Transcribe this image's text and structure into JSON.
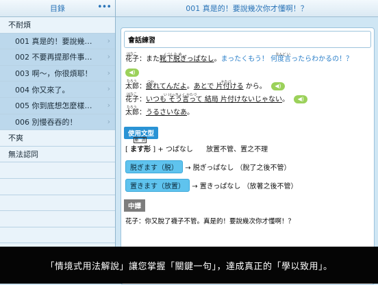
{
  "sidebar": {
    "title": "目錄",
    "more_icon": "•••",
    "items": [
      {
        "label": "不耐煩",
        "level": "top"
      },
      {
        "label": "001 真是的！要說幾次你才懂啊！？",
        "level": "sub"
      },
      {
        "label": "002 不要再提那件事了。",
        "level": "sub"
      },
      {
        "label": "003 啊～，你很煩耶！",
        "level": "sub"
      },
      {
        "label": "004 你又來了。",
        "level": "sub"
      },
      {
        "label": "005 你到底想怎麼樣呢？",
        "level": "sub"
      },
      {
        "label": "006 別慢吞吞的！",
        "level": "sub"
      },
      {
        "label": "不爽",
        "level": "top"
      },
      {
        "label": "無法認同",
        "level": "top"
      }
    ]
  },
  "main": {
    "title": "001 真是的！要說幾次你才懂啊！？",
    "practice_title": "會話練習",
    "lines": [
      {
        "speaker": "花子：",
        "speaker_ruby": "はなこ",
        "text_plain": "また",
        "text_ul": "靴下脱ぎっぱなし",
        "ruby": "くつした ぬ",
        "text_tail": "。",
        "text_blue": "まったくもう！ 何度言ったらわかるの！？",
        "blue_ruby": "なんど い"
      },
      {
        "speaker": "太郎：",
        "speaker_ruby": "たろう",
        "text_ul": "疲れてんだよ",
        "ruby": "つか",
        "text_mid": "。",
        "text_ul2": "あとで 片付ける",
        "ruby2": "かたづ",
        "text_tail": " から。"
      },
      {
        "speaker": "花子：",
        "speaker_ruby": "はなこ",
        "text_ul": "いつも そう言って 結局 片付けないじゃない",
        "ruby": "い    けっきょく  かたづ",
        "text_tail": "。"
      },
      {
        "speaker": "太郎：",
        "speaker_ruby": "たろう",
        "text_ul": "うるさいなあ",
        "text_tail": "。"
      }
    ],
    "usage_title": "使用文型",
    "pattern": {
      "marker": "動　詞",
      "form_label": "ます形",
      "plus": "+ つぱなし",
      "meaning": "放置不管、置之不理"
    },
    "examples": [
      {
        "pill": "脱ぎます（脱）",
        "arrow": "→",
        "result": "脱ぎっぱなし",
        "ruby": "ぬ",
        "note": "（脫了之後不管）"
      },
      {
        "pill": "置きます（放置）",
        "arrow": "→",
        "result": "置きっぱなし",
        "ruby": "お",
        "note": "（放著之後不管）"
      }
    ],
    "translation_title": "中譯",
    "translation_line": "花子：你又脫了襪子不管。真是的！要說幾次你才懂啊！？"
  },
  "caption": "「情境式用法解說」讓您掌握「關鍵一句」，達成真正的「學以致用」。"
}
